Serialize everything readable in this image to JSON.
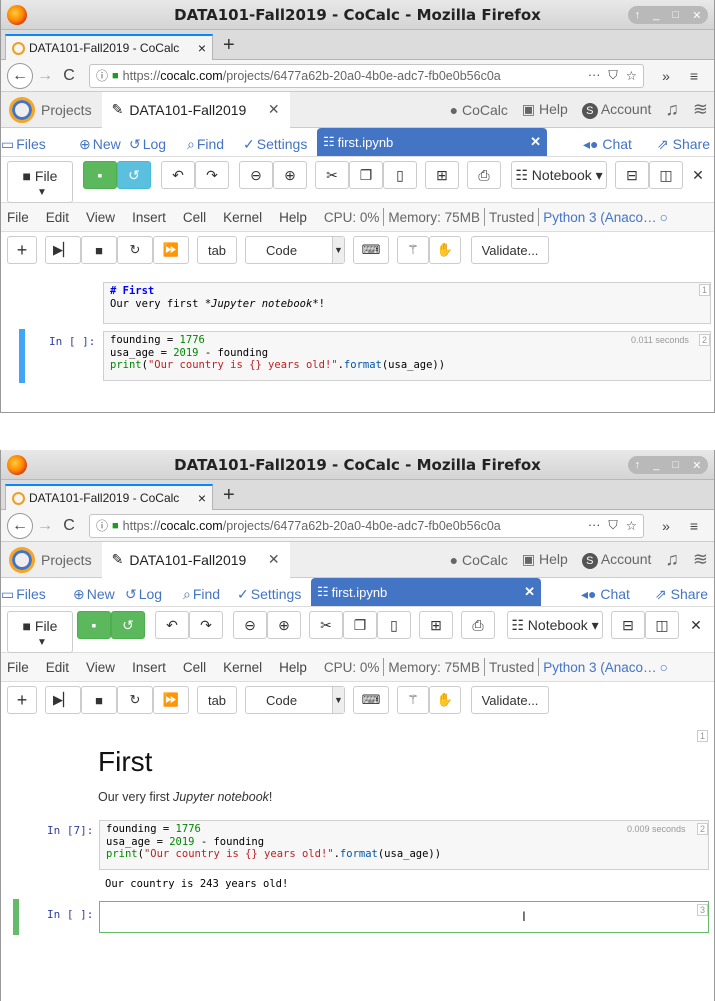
{
  "window": {
    "title": "DATA101-Fall2019 - CoCalc - Mozilla Firefox",
    "controls": "↑ _ □ ✕"
  },
  "tab": {
    "label": "DATA101-Fall2019 - CoCalc",
    "close": "×",
    "new": "+"
  },
  "nav": {
    "url_prefix": "https://",
    "url_host": "cocalc.com",
    "url_path": "/projects/6477a62b-20a0-4b0e-adc7-fb0e0b56c0a",
    "more": "···",
    "overflow": "»",
    "menu": "≡"
  },
  "cocalc": {
    "projects": "Projects",
    "project_tab": "DATA101-Fall2019",
    "cocalc_link": "CoCalc",
    "help": "Help",
    "account": "Account",
    "account_initial": "S"
  },
  "filetabs": {
    "files": "Files",
    "new": "New",
    "log": "Log",
    "find": "Find",
    "settings": "Settings",
    "open_file": "first.ipynb",
    "chat": "Chat",
    "share": "Share"
  },
  "toolbar": {
    "file": "File",
    "notebook": "Notebook ▾"
  },
  "menu": {
    "items": [
      "File",
      "Edit",
      "View",
      "Insert",
      "Cell",
      "Kernel",
      "Help"
    ],
    "cpu": "CPU: 0%",
    "memory": "Memory: 75MB",
    "trusted": "Trusted",
    "kernel": "Python 3 (Anaco…"
  },
  "celltoolbar": {
    "tab": "tab",
    "cell_type": "Code",
    "validate": "Validate..."
  },
  "shot1": {
    "md_line1": "# First",
    "md_line2_a": "Our very first *",
    "md_line2_em": "Jupyter notebook",
    "md_line2_b": "*!",
    "md_cell_num": "1",
    "code_prompt": "In [ ]:",
    "code_timing": "0.011 seconds",
    "code_cell_num": "2"
  },
  "shot2": {
    "md_cell_num": "1",
    "heading": "First",
    "para_a": "Our very first ",
    "para_em": "Jupyter notebook",
    "para_b": "!",
    "code_prompt": "In [7]:",
    "code_timing": "0.009 seconds",
    "code_cell_num": "2",
    "output": "Our country is 243 years old!",
    "empty_prompt": "In [ ]:",
    "empty_cell_num": "3"
  },
  "code": {
    "l1_var": "founding = ",
    "l1_num": "1776",
    "l2_var": "usa_age = ",
    "l2_num": "2019",
    "l2_rest": " - founding",
    "l3_fn": "print",
    "l3_str": "\"Our country is {} years old!\"",
    "l3_dot": ".",
    "l3_meth": "format",
    "l3_arg": "(usa_age))"
  },
  "colors": {
    "accent": "#4474c4",
    "green": "#5cb85c",
    "selection_blue": "#42a5f5",
    "selection_green": "#66bb6a"
  }
}
